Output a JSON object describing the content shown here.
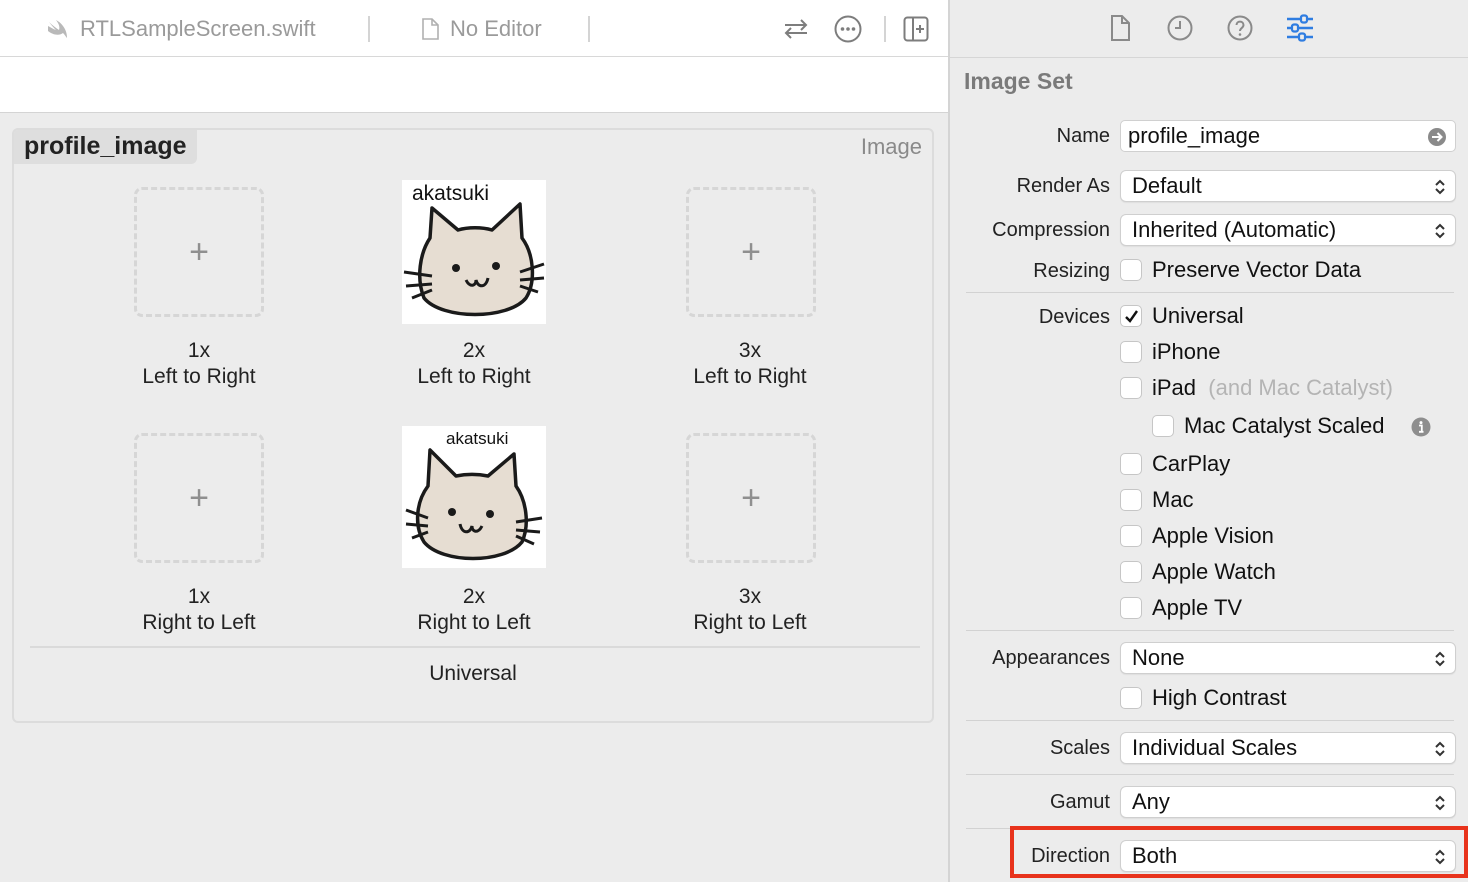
{
  "editor": {
    "tabs": [
      {
        "label": "RTLSampleScreen.swift",
        "icon": "swift-icon"
      },
      {
        "label": "No Editor",
        "icon": "document-icon"
      }
    ],
    "toolbar_icons": [
      "swap-arrows-icon",
      "ellipsis-circle-icon",
      "add-editor-icon"
    ]
  },
  "image_set": {
    "name": "profile_image",
    "kind_label": "Image",
    "group_label": "Universal",
    "thumbnail_caption_2x_ltr": "akatsuki",
    "thumbnail_caption_2x_rtl": "akatsuki",
    "slots": [
      {
        "scale": "1x",
        "direction": "Left to Right",
        "filled": false
      },
      {
        "scale": "2x",
        "direction": "Left to Right",
        "filled": true
      },
      {
        "scale": "3x",
        "direction": "Left to Right",
        "filled": false
      },
      {
        "scale": "1x",
        "direction": "Right to Left",
        "filled": false
      },
      {
        "scale": "2x",
        "direction": "Right to Left",
        "filled": true
      },
      {
        "scale": "3x",
        "direction": "Right to Left",
        "filled": false
      }
    ],
    "empty_slot_glyph": "+"
  },
  "inspector": {
    "tab_icons": [
      "file-icon",
      "history-clock-icon",
      "help-icon",
      "attributes-sliders-icon"
    ],
    "active_tab": "attributes-sliders-icon",
    "title": "Image Set",
    "name_label": "Name",
    "name_value": "profile_image",
    "render_as_label": "Render As",
    "render_as_value": "Default",
    "compression_label": "Compression",
    "compression_value": "Inherited (Automatic)",
    "resizing_label": "Resizing",
    "preserve_vector": {
      "label": "Preserve Vector Data",
      "checked": false
    },
    "devices_label": "Devices",
    "devices": [
      {
        "label": "Universal",
        "checked": true
      },
      {
        "label": "iPhone",
        "checked": false
      },
      {
        "label": "iPad",
        "suffix": "(and Mac Catalyst)",
        "checked": false
      },
      {
        "label": "Mac Catalyst Scaled",
        "checked": false
      },
      {
        "label": "CarPlay",
        "checked": false
      },
      {
        "label": "Mac",
        "checked": false
      },
      {
        "label": "Apple Vision",
        "checked": false
      },
      {
        "label": "Apple Watch",
        "checked": false
      },
      {
        "label": "Apple TV",
        "checked": false
      }
    ],
    "appearances_label": "Appearances",
    "appearances_value": "None",
    "high_contrast": {
      "label": "High Contrast",
      "checked": false
    },
    "scales_label": "Scales",
    "scales_value": "Individual Scales",
    "gamut_label": "Gamut",
    "gamut_value": "Any",
    "direction_label": "Direction",
    "direction_value": "Both"
  },
  "colors": {
    "accent": "#2f7de1",
    "highlight_box": "#e8331c",
    "panel_bg": "#ececec"
  }
}
